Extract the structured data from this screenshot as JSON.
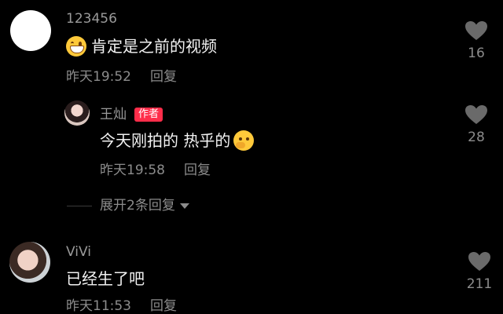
{
  "comments": [
    {
      "username": "123456",
      "text": "肯定是之前的视频",
      "emoji": "grinning-face-emoji",
      "time": "昨天19:52",
      "reply_label": "回复",
      "likes": "16"
    },
    {
      "username": "王灿",
      "badge": "作者",
      "text": "今天刚拍的 热乎的",
      "emoji": "thinking-face-emoji",
      "time": "昨天19:58",
      "reply_label": "回复",
      "likes": "28"
    },
    {
      "username": "ViVi",
      "text": "已经生了吧",
      "time": "昨天11:53",
      "reply_label": "回复",
      "likes": "211"
    }
  ],
  "expand_replies": {
    "label": "展开2条回复",
    "icon": "caret-down-icon"
  },
  "colors": {
    "background": "#000000",
    "username": "#9a9a9a",
    "text": "#f2f2f2",
    "meta": "#8c8c8c",
    "badge": "#ff2d4a"
  }
}
